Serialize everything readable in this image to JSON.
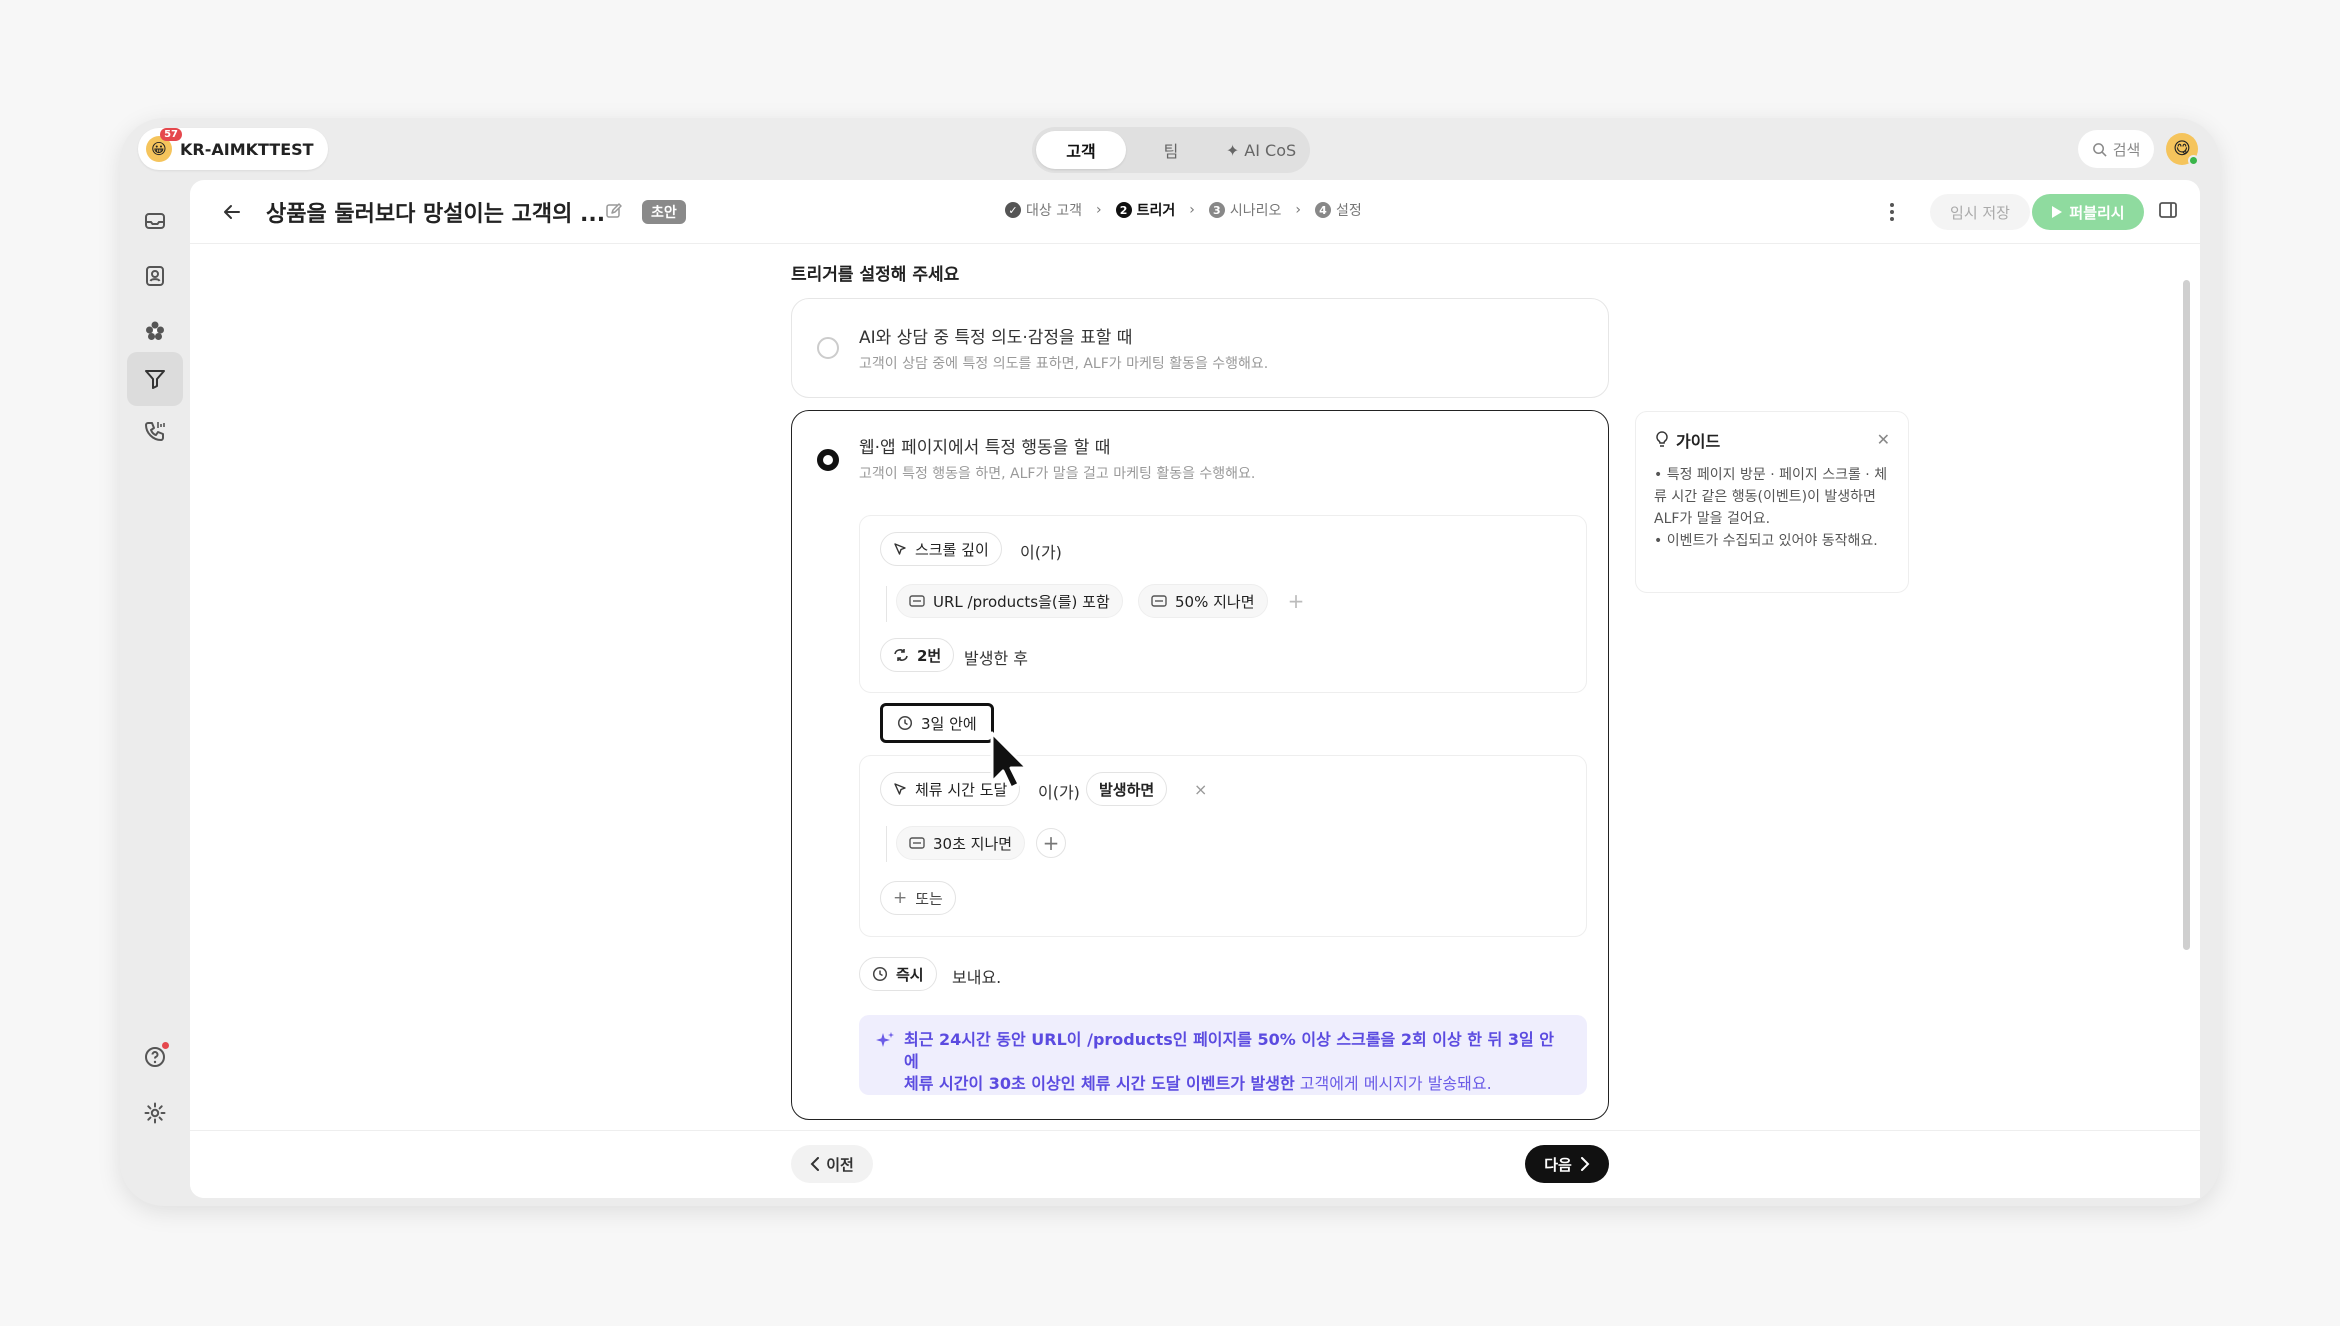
{
  "workspace": {
    "name": "KR-AIMKTTEST",
    "badge": "57",
    "avatar": "😀"
  },
  "top_tabs": [
    {
      "label": "고객",
      "active": true
    },
    {
      "label": "팀",
      "active": false
    },
    {
      "label": "✦ AI CoS",
      "active": false
    }
  ],
  "search": {
    "label": "검색"
  },
  "user": {
    "avatar": "😋"
  },
  "sidebar": {
    "items": [
      {
        "icon": "inbox-icon"
      },
      {
        "icon": "contacts-icon"
      },
      {
        "icon": "flower-icon"
      },
      {
        "icon": "funnel-icon",
        "active": true
      },
      {
        "icon": "phone-icon"
      }
    ],
    "bottom": [
      {
        "icon": "help-icon"
      },
      {
        "icon": "settings-icon"
      }
    ]
  },
  "header": {
    "title": "상품을 둘러보다 망설이는 고객의 ...",
    "badge": "초안",
    "steps": [
      {
        "num": "✓",
        "label": "대상 고객",
        "state": "done"
      },
      {
        "num": "2",
        "label": "트리거",
        "state": "current"
      },
      {
        "num": "3",
        "label": "시나리오",
        "state": "todo"
      },
      {
        "num": "4",
        "label": "설정",
        "state": "todo"
      }
    ],
    "save_label": "임시 저장",
    "publish_label": "퍼블리시"
  },
  "content": {
    "section_title": "트리거를 설정해 주세요",
    "option1": {
      "title": "AI와 상담 중 특정 의도·감정을 표할 때",
      "desc": "고객이 상담 중에 특정 의도를 표하면, ALF가 마케팅 활동을 수행해요."
    },
    "option2": {
      "title": "웹·앱 페이지에서 특정 행동을 할 때",
      "desc": "고객이 특정 행동을 하면, ALF가 말을 걸고 마케팅 활동을 수행해요.",
      "event1": {
        "name": "스크롤 깊이",
        "suffix": "이(가)",
        "filter1": "URL /products을(를) 포함",
        "filter2": "50% 지나면",
        "count": "2번",
        "count_suffix": "발생한 후"
      },
      "window": "3일 안에",
      "event2": {
        "name": "체류 시간 도달",
        "suffix": "이(가)",
        "action": "발생하면",
        "filter1": "30초 지나면",
        "or_label": "또는"
      },
      "timing": "즉시",
      "timing_suffix": "보내요.",
      "summary": {
        "part1": "최근 24시간 동안 URL이 /products인 페이지를 50% 이상 스크롤을 2회 이상 한 뒤 3일 안에",
        "part2": "체류 시간이 30초 이상인 체류 시간 도달 이벤트가 발생한",
        "part3": " 고객에게 메시지가 발송돼요."
      }
    }
  },
  "guide": {
    "title": "가이드",
    "line1": "• 특정 페이지 방문 · 페이지 스크롤 · 체류 시간 같은 행동(이벤트)이 발생하면 ALF가 말을 걸어요.",
    "line2": "• 이벤트가 수집되고 있어야 동작해요."
  },
  "footer": {
    "prev_label": "이전",
    "next_label": "다음"
  },
  "colors": {
    "accent_purple": "#6b5ce7",
    "publish_green": "#8fdb9f",
    "badge_red": "#e5484d"
  }
}
